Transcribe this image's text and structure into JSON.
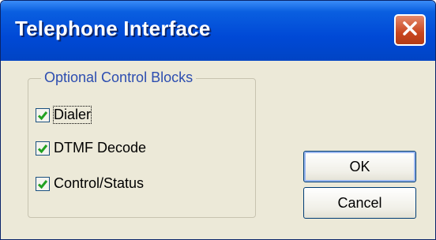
{
  "window": {
    "title": "Telephone Interface",
    "close_icon": "close-x-icon"
  },
  "group": {
    "legend": "Optional Control Blocks",
    "items": [
      {
        "label": "Dialer",
        "checked": true,
        "focused": true
      },
      {
        "label": "DTMF Decode",
        "checked": true,
        "focused": false
      },
      {
        "label": "Control/Status",
        "checked": true,
        "focused": false
      }
    ]
  },
  "buttons": {
    "ok_label": "OK",
    "cancel_label": "Cancel"
  },
  "colors": {
    "title_bar": "#0049d6",
    "close_button": "#c9461f",
    "dialog_background": "#ece9d8",
    "check_mark": "#21a121",
    "group_label": "#2c4db0"
  }
}
